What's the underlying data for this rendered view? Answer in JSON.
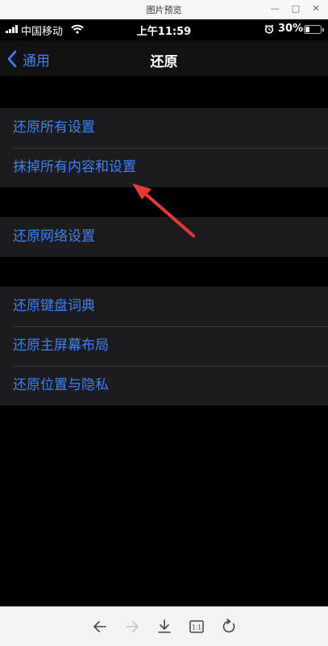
{
  "viewer": {
    "title": "图片预览",
    "window_controls": {
      "minimize": "—",
      "maximize": "□",
      "close": "✕"
    },
    "toolbar_icons": [
      "arrow-left-icon",
      "arrow-right-icon",
      "download-icon",
      "actual-size-icon",
      "rotate-icon"
    ],
    "actual_size_label": "1:1"
  },
  "phone": {
    "status_bar": {
      "carrier": "中国移动",
      "time": "上午11:59",
      "battery_percent": "30%",
      "battery_level": 0.3
    },
    "nav": {
      "back_label": "通用",
      "title": "还原"
    },
    "groups": [
      {
        "items": [
          {
            "label": "还原所有设置"
          },
          {
            "label": "抹掉所有内容和设置"
          }
        ]
      },
      {
        "items": [
          {
            "label": "还原网络设置"
          }
        ]
      },
      {
        "items": [
          {
            "label": "还原键盘词典"
          },
          {
            "label": "还原主屏幕布局"
          },
          {
            "label": "还原位置与隐私"
          }
        ]
      }
    ],
    "colors": {
      "accent": "#3b82f6",
      "annotation_arrow": "#e53935",
      "cell_background": "#1c1c1e",
      "screen_background": "#000000"
    }
  }
}
